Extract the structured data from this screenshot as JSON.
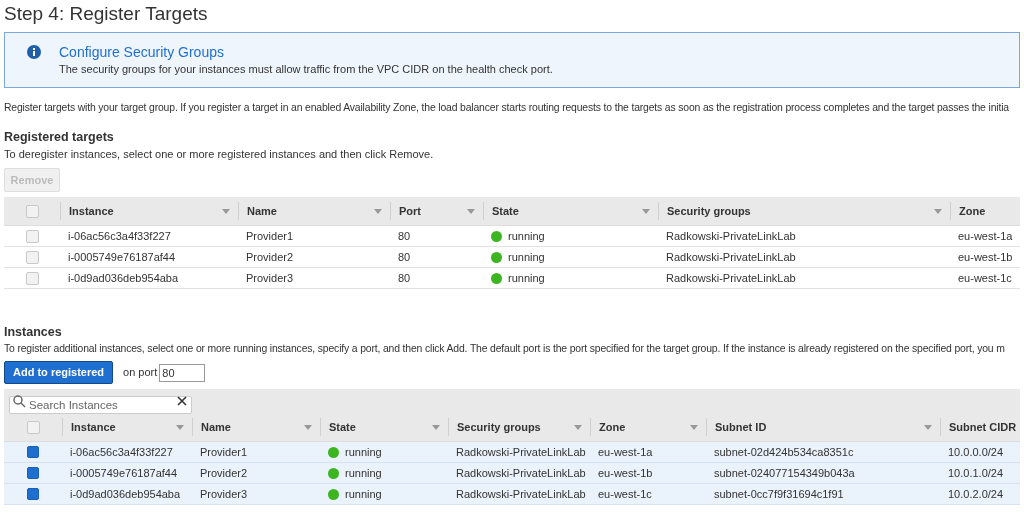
{
  "title": "Step 4: Register Targets",
  "info": {
    "title": "Configure Security Groups",
    "text": "The security groups for your instances must allow traffic from the VPC CIDR on the health check port."
  },
  "intro": "Register targets with your target group. If you register a target in an enabled Availability Zone, the load balancer starts routing requests to the targets as soon as the registration process completes and the target passes the initia",
  "registered": {
    "heading": "Registered targets",
    "text": "To deregister instances, select one or more registered instances and then click Remove.",
    "remove_button": {
      "label": "Remove",
      "disabled": true
    },
    "select_all": false,
    "columns": [
      "Instance",
      "Name",
      "Port",
      "State",
      "Security groups",
      "Zone"
    ],
    "rows": [
      {
        "checked": false,
        "cells": [
          "i-06ac56c3a4f33f227",
          "Provider1",
          "80",
          "running",
          "Radkowski-PrivateLinkLab",
          "eu-west-1a"
        ]
      },
      {
        "checked": false,
        "cells": [
          "i-0005749e76187af44",
          "Provider2",
          "80",
          "running",
          "Radkowski-PrivateLinkLab",
          "eu-west-1b"
        ]
      },
      {
        "checked": false,
        "cells": [
          "i-0d9ad036deb954aba",
          "Provider3",
          "80",
          "running",
          "Radkowski-PrivateLinkLab",
          "eu-west-1c"
        ]
      }
    ]
  },
  "instances": {
    "heading": "Instances",
    "text": "To register additional instances, select one or more running instances, specify a port, and then click Add. The default port is the port specified for the target group. If the instance is already registered on the specified port, you m",
    "add_button": "Add to registered",
    "port_label": "on port",
    "port_value": "80",
    "search_placeholder": "Search Instances",
    "select_all": false,
    "columns": [
      "Instance",
      "Name",
      "State",
      "Security groups",
      "Zone",
      "Subnet ID",
      "Subnet CIDR"
    ],
    "rows": [
      {
        "checked": true,
        "cells": [
          "i-06ac56c3a4f33f227",
          "Provider1",
          "running",
          "Radkowski-PrivateLinkLab",
          "eu-west-1a",
          "subnet-02d424b534ca8351c",
          "10.0.0.0/24"
        ]
      },
      {
        "checked": true,
        "cells": [
          "i-0005749e76187af44",
          "Provider2",
          "running",
          "Radkowski-PrivateLinkLab",
          "eu-west-1b",
          "subnet-024077154349b043a",
          "10.0.1.0/24"
        ]
      },
      {
        "checked": true,
        "cells": [
          "i-0d9ad036deb954aba",
          "Provider3",
          "running",
          "Radkowski-PrivateLinkLab",
          "eu-west-1c",
          "subnet-0cc7f9f31694c1f91",
          "10.0.2.0/24"
        ]
      }
    ]
  }
}
